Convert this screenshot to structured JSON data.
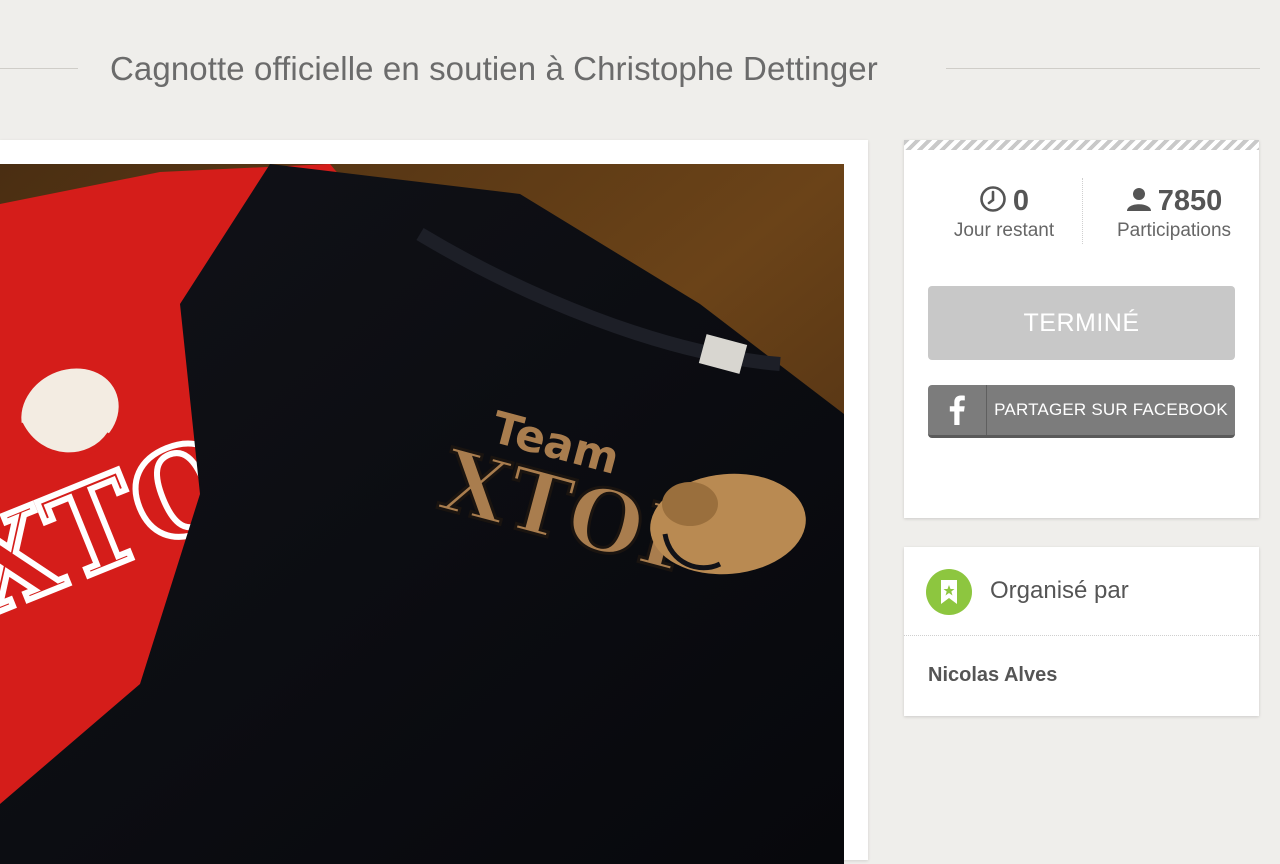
{
  "header": {
    "title": "Cagnotte officielle en soutien à Christophe Dettinger"
  },
  "media": {
    "shirt_left_text": "XTOF",
    "shirt_main_small_text": "Team",
    "shirt_main_big_text": "XTOF",
    "shirt_main_big_text_bottom": "XTOF"
  },
  "stats": {
    "days_value": "0",
    "days_label": "Jour restant",
    "participants_value": "7850",
    "participants_label": "Participations",
    "days_icon": "clock-icon",
    "participants_icon": "person-icon"
  },
  "actions": {
    "status_label": "TERMINÉ",
    "facebook_label": "PARTAGER SUR FACEBOOK",
    "facebook_icon": "facebook-icon"
  },
  "organizer": {
    "title": "Organisé par",
    "name": "Nicolas Alves",
    "badge_icon": "bookmark-star-icon"
  },
  "colors": {
    "background": "#efeeeb",
    "status_button": "#c8c8c8",
    "facebook_button": "#7c7c7c",
    "organizer_badge": "#8dc63f"
  }
}
